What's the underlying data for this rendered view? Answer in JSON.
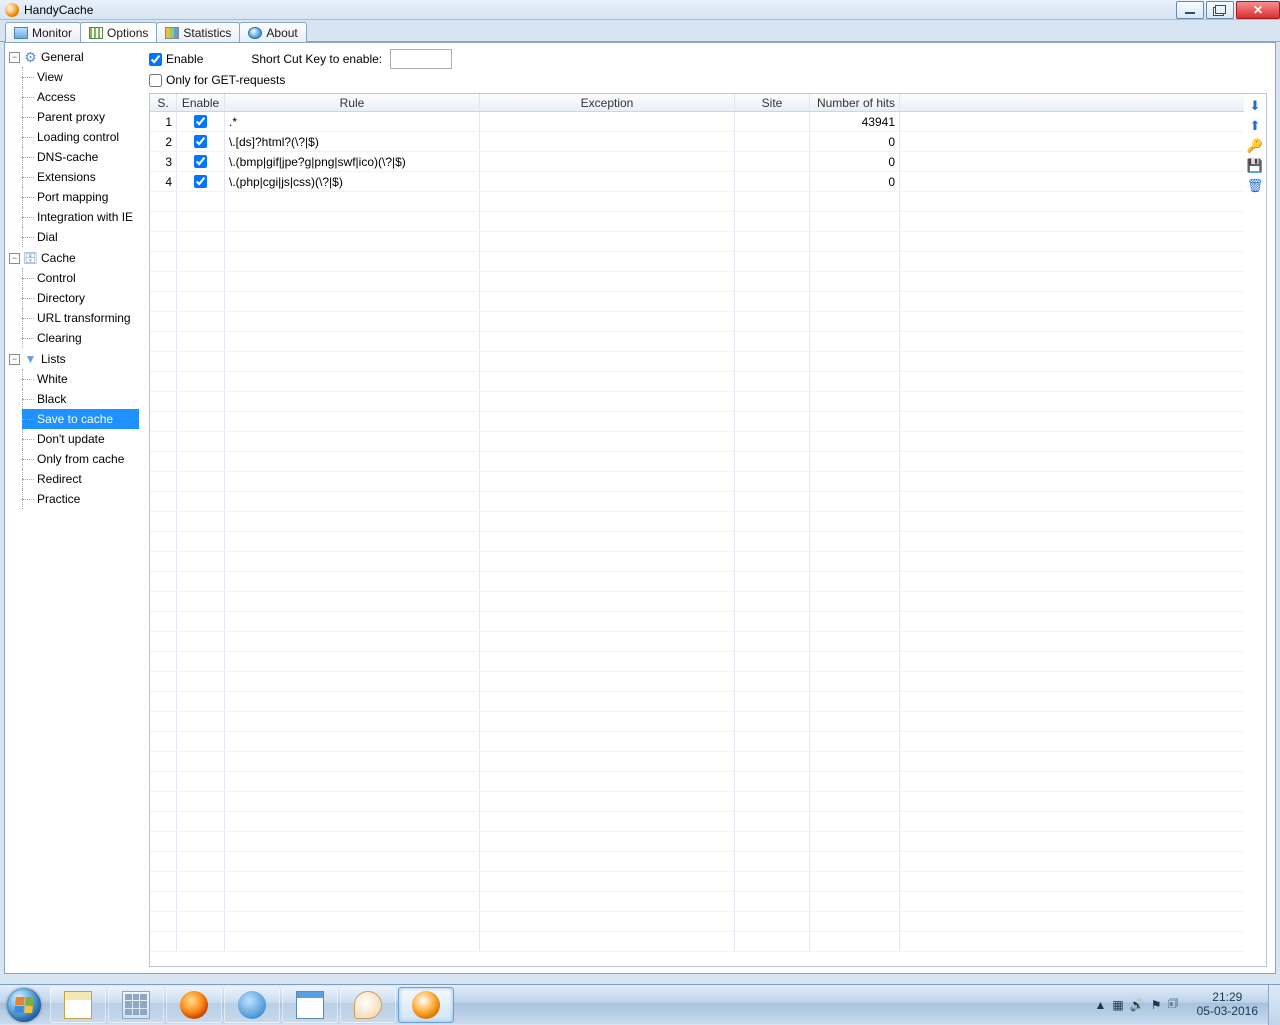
{
  "window": {
    "title": "HandyCache"
  },
  "tabs": [
    {
      "label": "Monitor"
    },
    {
      "label": "Options"
    },
    {
      "label": "Statistics"
    },
    {
      "label": "About"
    }
  ],
  "tree": {
    "general": {
      "label": "General",
      "items": [
        "View",
        "Access",
        "Parent proxy",
        "Loading control",
        "DNS-cache",
        "Extensions",
        "Port mapping",
        "Integration with IE",
        "Dial"
      ]
    },
    "cache": {
      "label": "Cache",
      "items": [
        "Control",
        "Directory",
        "URL transforming",
        "Clearing"
      ]
    },
    "lists": {
      "label": "Lists",
      "items": [
        "White",
        "Black",
        "Save to cache",
        "Don't update",
        "Only from cache",
        "Redirect",
        "Practice"
      ],
      "selected": "Save to cache"
    }
  },
  "panel": {
    "enable": {
      "label": "Enable",
      "checked": true
    },
    "shortcut_label": "Short Cut Key to enable:",
    "shortcut_value": "",
    "only_get": {
      "label": "Only for GET-requests",
      "checked": false
    },
    "columns": {
      "s": "S.",
      "enable": "Enable",
      "rule": "Rule",
      "exception": "Exception",
      "site": "Site",
      "hits": "Number of hits"
    },
    "rows": [
      {
        "s": "1",
        "enabled": true,
        "rule": ".*",
        "exception": "",
        "site": "",
        "hits": "43941"
      },
      {
        "s": "2",
        "enabled": true,
        "rule": "\\.[ds]?html?(\\?|$)",
        "exception": "",
        "site": "",
        "hits": "0"
      },
      {
        "s": "3",
        "enabled": true,
        "rule": "\\.(bmp|gif|jpe?g|png|swf|ico)(\\?|$)",
        "exception": "",
        "site": "",
        "hits": "0"
      },
      {
        "s": "4",
        "enabled": true,
        "rule": "\\.(php|cgi|js|css)(\\?|$)",
        "exception": "",
        "site": "",
        "hits": "0"
      }
    ]
  },
  "side_icons": [
    "down-arrow-icon",
    "up-arrow-icon",
    "key-icon",
    "save-icon",
    "delete-icon"
  ],
  "system": {
    "tray_icons": [
      "show-hidden-icon",
      "grid-icon",
      "speaker-icon",
      "flag-icon",
      "battery-icon"
    ],
    "time": "21:29",
    "date": "05-03-2016"
  }
}
